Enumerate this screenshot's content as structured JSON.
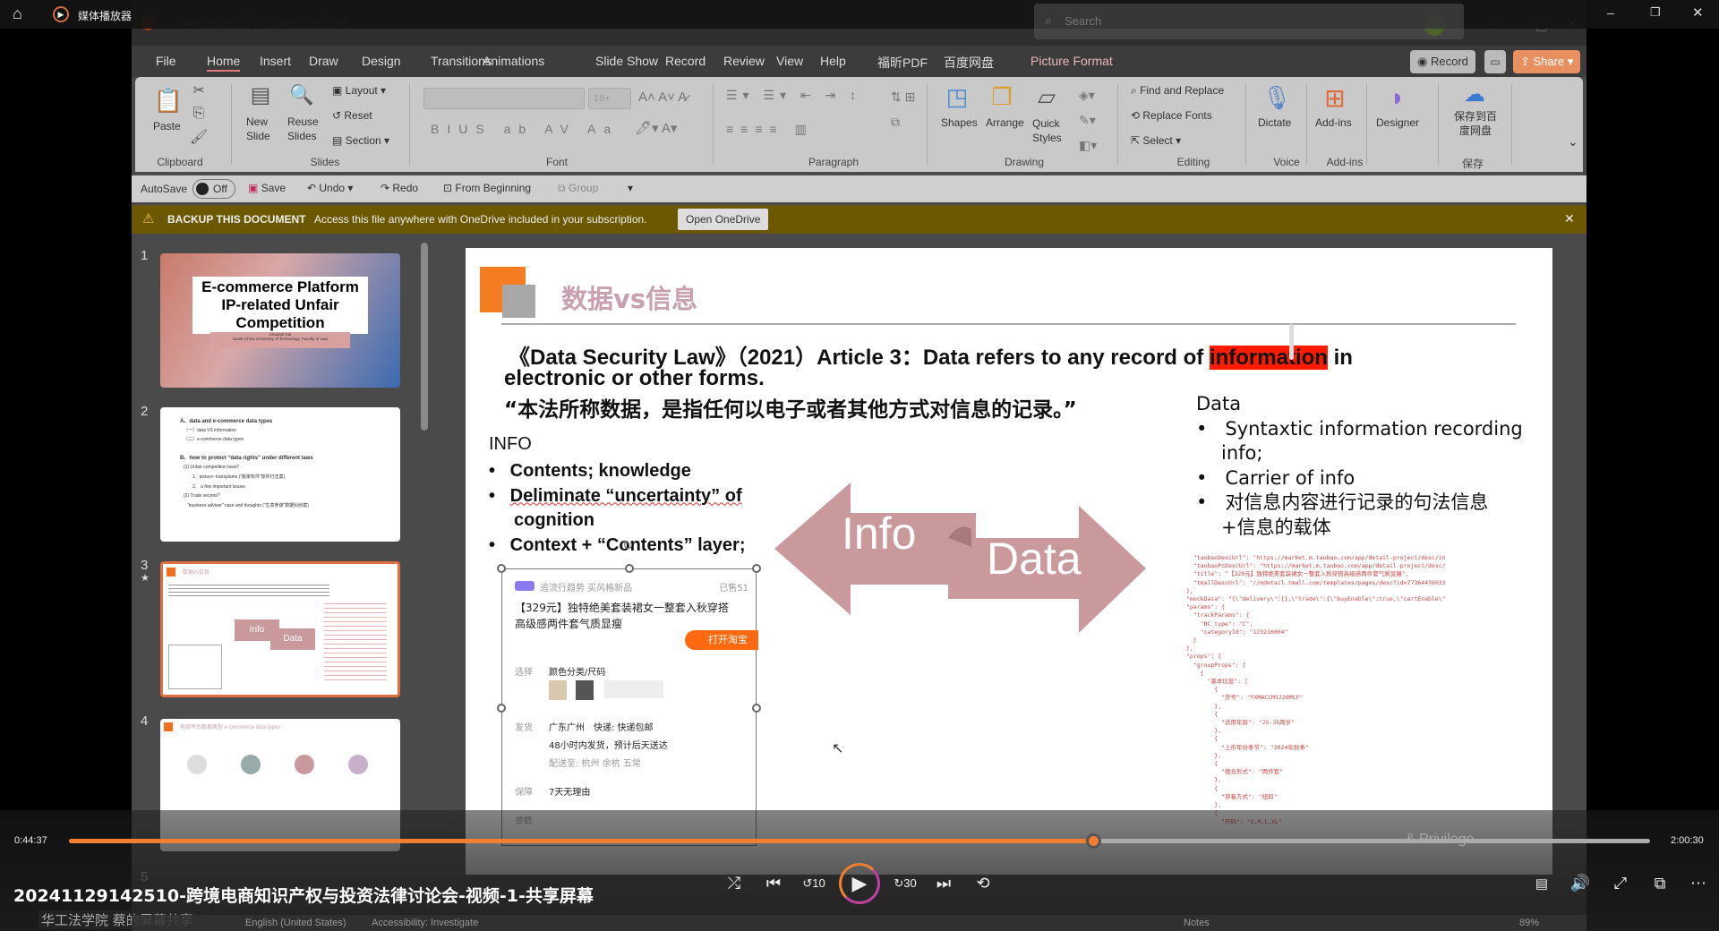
{
  "player": {
    "app_name": "媒体播放器",
    "time_current": "0:44:37",
    "time_total": "2:00:30",
    "progress": 0.648,
    "video_title": "20241129142510-跨境电商知识产权与投资法律讨论会-视频-1-共享屏幕",
    "watermark": "华工法学院 蔡的屏幕共享",
    "accent": "#f08030"
  },
  "ppt": {
    "title": "Presentation1 • Saved to this PC",
    "search_placeholder": "Search",
    "user_initials": "CC",
    "tabs": [
      "File",
      "Home",
      "Insert",
      "Draw",
      "Design",
      "Transitions",
      "Animations",
      "Slide Show",
      "Record",
      "Review",
      "View",
      "Help",
      "福昕PDF",
      "百度网盘",
      "Picture Format"
    ],
    "record_btn": "Record",
    "share_btn": "Share",
    "ribbon": {
      "paste": "Paste",
      "new_slide": "New Slide",
      "reuse_slides": "Reuse Slides",
      "layout": "Layout",
      "reset": "Reset",
      "section": "Section",
      "font_size": "18+",
      "shapes": "Shapes",
      "arrange": "Arrange",
      "quick_styles": "Quick Styles",
      "find_replace": "Find and Replace",
      "replace_fonts": "Replace Fonts",
      "select": "Select",
      "dictate": "Dictate",
      "addins": "Add-ins",
      "designer": "Designer",
      "save_baidu": "保存到百度网盘",
      "groups": [
        "Clipboard",
        "Slides",
        "Font",
        "Paragraph",
        "Drawing",
        "Editing",
        "Voice",
        "Add-ins",
        "保存"
      ]
    },
    "qat": {
      "autosave": "AutoSave",
      "autosave_state": "Off",
      "save": "Save",
      "undo": "Undo",
      "redo": "Redo",
      "from_beginning": "From Beginning",
      "group": "Group"
    },
    "banner": {
      "title": "BACKUP THIS DOCUMENT",
      "message": "Access this file anywhere with OneDrive included in your subscription.",
      "button": "Open OneDrive"
    },
    "thumbnails": {
      "numbers": [
        "1",
        "2",
        "3",
        "4",
        "5"
      ],
      "s1": {
        "title": "E-commerce Platform IP-related Unfair Competition",
        "author": "Chuanxi Cai",
        "affil": "South China University of Technology, Faculty of Law"
      },
      "s2": [
        "A、data and e-commerce data types",
        "（一）data VS information",
        "（二）e-commerce data types",
        "B、how to protect “data rights” under different laws",
        "(1) Unfair competition laws?",
        "1、picture- transplants (“搬家软件”软件打击案)",
        "2、 a few important issues",
        "(2) Trade secrets?",
        "“business adviser” case and thoughts (“生意参谋”数据纠纷案)"
      ],
      "s3": {
        "title": "数据vs信息",
        "info": "Info",
        "data": "Data"
      },
      "s4": {
        "title": "电商平台数据类型 e-commerce data types"
      }
    },
    "status": {
      "language": "English (United States)",
      "accessibility": "Accessibility: Investigate",
      "notes": "Notes",
      "zoom": "89%"
    }
  },
  "slide": {
    "title": "数据vs信息",
    "law_line1_a": "《Data Security Law》（2021）Article 3：Data refers to any record of ",
    "law_highlight": "information",
    "law_line1_b": " in",
    "law_line2": "electronic or other forms.",
    "law_line3": "“本法所称数据，是指任何以电子或者其他方式对信息的记录。”",
    "info_heading": "INFO",
    "info_bullets": [
      "Contents; knowledge",
      "Deliminate “uncertainty” of",
      "cognition",
      "Context + “Contents” layer;"
    ],
    "data_heading": "Data",
    "data_bullets": [
      "Syntaxtic information recording",
      "info;",
      "Carrier of info",
      "对信息内容进行记录的句法信息",
      "+信息的载体"
    ],
    "arrow_info": "Info",
    "arrow_data": "Data",
    "arrow_color": "#c9999c",
    "highlight_color": "#ff1a00",
    "taobao": {
      "tag": "追流行趋势 买风格新品",
      "sold": "已售51",
      "title1": "【329元】独特绝美套装裙女一整套入秋穿搭",
      "title2": "高级感两件套气质显瘦",
      "open_btn": "打开淘宝",
      "r1_label": "选择",
      "r1_val": "颜色分类/尺码",
      "r2_label": "发货",
      "r2_val": "广东广州　快递: 快递包邮",
      "r2_sub": "48小时内发货，预计后天送达",
      "r2_sub2": "配送至: 杭州 余杭 五常",
      "r3_label": "保障",
      "r3_val": "7天无理由",
      "r4_label": "参数"
    },
    "code_lines": [
      "  \"taobaoDescUrl\": \"https://market.m.taobao.com/app/detail-project/desc/index.html?i",
      "  \"taobaoPcDescUrl\": \"https://market.m.taobao.com/app/detail-project/desc/index.html",
      "  \"title\": \"【329元】独特绝美套装裙女一整套入秋穿搭高级感两件套气质显瘦\",",
      "  \"tmallDescUrl\": \"//mdetail.tmall.com/templates/pages/desc?id=773644760330\"",
      "},",
      "\"mockData\": \"{\\\"delivery\\\":{},\\\"trade\\\":{\\\"buyEnable\\\":true,\\\"cartEnable\\\":true},\\\"fea",
      "\"params\": {",
      "  \"trackParams\": {",
      "    \"BC_type\": \"C\",",
      "    \"categoryId\": \"123216004\"",
      "  }",
      "},",
      "\"props\": {",
      "  \"groupProps\": [",
      "    {",
      "      \"基本信息\": [",
      "        {",
      "          \"货号\": \"FXMACCM5720MCF\"",
      "        },",
      "        {",
      "          \"适用年龄\": \"25-35周岁\"",
      "        },",
      "        {",
      "          \"上市年份季节\": \"2024年秋季\"",
      "        },",
      "        {",
      "          \"组合形式\": \"两件套\"",
      "        },",
      "        {",
      "          \"穿着方式\": \"纽扣\"",
      "        },",
      "        {",
      "          \"尺码\": \"S,M,L,XL\""
    ],
    "privilege": "& Privilege"
  }
}
